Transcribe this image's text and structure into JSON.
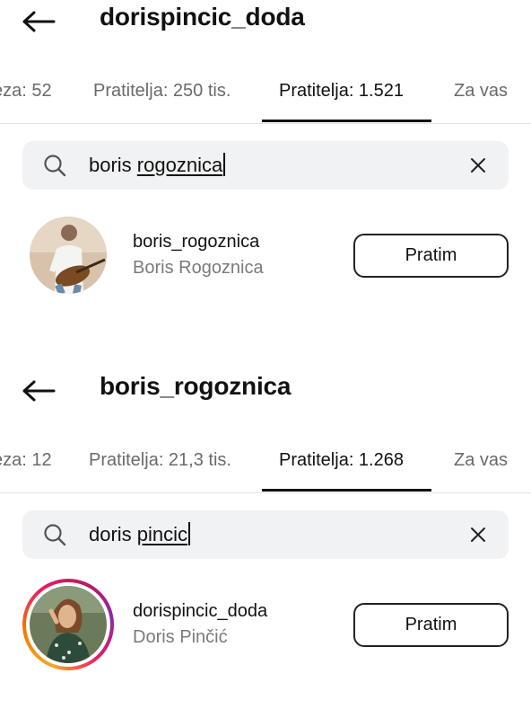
{
  "panels": [
    {
      "title": "dorispincic_doda",
      "tabs": [
        {
          "label": "eza: 52"
        },
        {
          "label": "Pratitelja: 250 tis."
        },
        {
          "label": "Pratitelja: 1.521"
        },
        {
          "label": "Za vas"
        }
      ],
      "active_tab": "Pratitelja: 1.521",
      "search": {
        "prefix": "boris ",
        "underlined": "rogoznica"
      },
      "result": {
        "username": "boris_rogoznica",
        "fullname": "Boris Rogoznica",
        "button_label": "Pratim",
        "story_ring": false
      }
    },
    {
      "title": "boris_rogoznica",
      "tabs": [
        {
          "label": "eza: 12"
        },
        {
          "label": "Pratitelja: 21,3 tis."
        },
        {
          "label": "Pratitelja: 1.268"
        },
        {
          "label": "Za vas"
        }
      ],
      "active_tab": "Pratitelja: 1.268",
      "search": {
        "prefix": "doris ",
        "underlined": "pincic"
      },
      "result": {
        "username": "dorispincic_doda",
        "fullname": "Doris Pinčić",
        "button_label": "Pratim",
        "story_ring": true
      }
    }
  ],
  "icons": {
    "back": "arrow-left-icon",
    "search": "search-icon",
    "clear": "close-icon"
  },
  "colors": {
    "text": "#111111",
    "secondary_text": "#7a7a7a",
    "search_bg": "#f1f2f4",
    "story_ring": [
      "#f9a825",
      "#e91e63",
      "#8e24aa"
    ]
  }
}
